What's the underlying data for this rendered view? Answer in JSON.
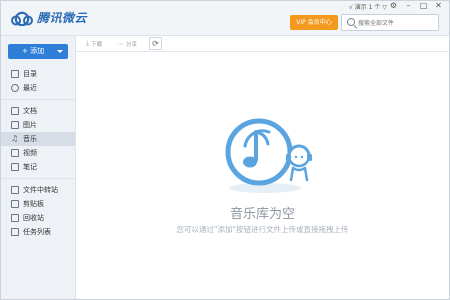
{
  "app": {
    "title": "腾讯微云"
  },
  "header": {
    "vip_label": "VIP 会员中心",
    "search_placeholder": "搜索全部文件",
    "user_label": "√ 演示 1 个 ▽",
    "sys": {
      "settings": "⚙",
      "minimize": "–",
      "maximize": "□",
      "close": "✕"
    }
  },
  "sidebar": {
    "add_label": "+ 添加",
    "groups": [
      [
        {
          "label": "目录",
          "icon": "directory-icon"
        },
        {
          "label": "最近",
          "icon": "clock-icon"
        }
      ],
      [
        {
          "label": "文档",
          "icon": "document-icon"
        },
        {
          "label": "图片",
          "icon": "image-icon"
        },
        {
          "label": "音乐",
          "icon": "music-icon",
          "active": true
        },
        {
          "label": "视频",
          "icon": "video-icon"
        },
        {
          "label": "笔记",
          "icon": "note-icon"
        }
      ],
      [
        {
          "label": "文件中转站",
          "icon": "transfer-icon"
        },
        {
          "label": "剪贴板",
          "icon": "clipboard-icon"
        },
        {
          "label": "回收站",
          "icon": "recycle-bin-icon"
        },
        {
          "label": "任务列表",
          "icon": "task-list-icon"
        }
      ]
    ]
  },
  "toolbar": {
    "download_label": "下载",
    "share_label": "分享",
    "refresh_glyph": "⟳"
  },
  "empty": {
    "title": "音乐库为空",
    "desc": "您可以通过\"添加\"按钮进行文件上传或直接拖拽上传"
  },
  "colors": {
    "accent": "#2f7fd9",
    "vip": "#f39a1e",
    "empty_icon": "#5aa4e0"
  }
}
